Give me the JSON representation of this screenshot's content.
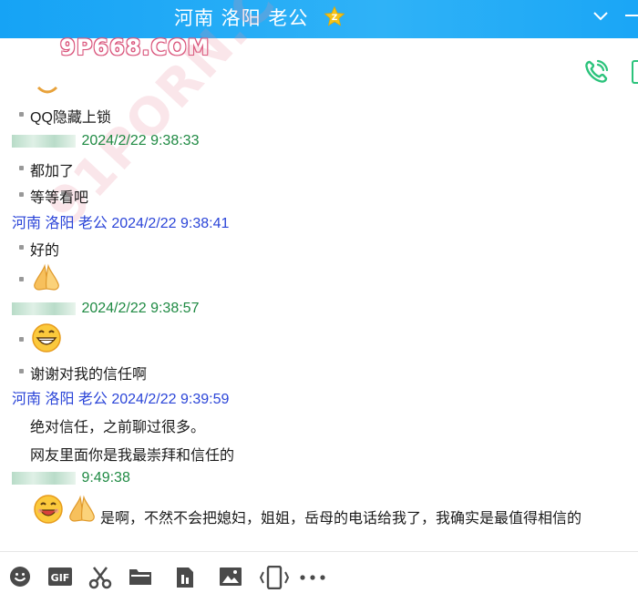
{
  "window": {
    "title": "河南 洛阳 老公",
    "watermark_top": "9P668.COM",
    "watermark_diag": "91PORN.COM"
  },
  "colors": {
    "titlebar": "#1aa6f6",
    "time_green": "#1f8a43",
    "sender_blue": "#2b45d8",
    "phone_green": "#2bc37b"
  },
  "chat": {
    "line1": "QQ隐藏上锁",
    "meta1_time": "2024/2/22 9:38:33",
    "line2": "都加了",
    "line3": "等等看吧",
    "meta2_sender": "河南 洛阳 老公",
    "meta2_time": "2024/2/22 9:38:41",
    "line4": "好的",
    "meta3_time": "2024/2/22 9:38:57",
    "line6": "谢谢对我的信任啊",
    "meta4_sender": "河南 洛阳 老公",
    "meta4_time": "2024/2/22 9:39:59",
    "line7": "绝对信任，之前聊过很多。",
    "line8": "网友里面你是我最崇拜和信任的",
    "meta5_time": "9:49:38",
    "line9": "是啊，不然不会把媳妇，姐姐，岳母的电话给我了，我确实是最值得相信的"
  },
  "toolbar": {
    "icons": [
      "emoji-icon",
      "gif-icon",
      "scissors-icon",
      "folder-icon",
      "file-icon",
      "image-icon",
      "shake-icon",
      "more-icon"
    ]
  }
}
